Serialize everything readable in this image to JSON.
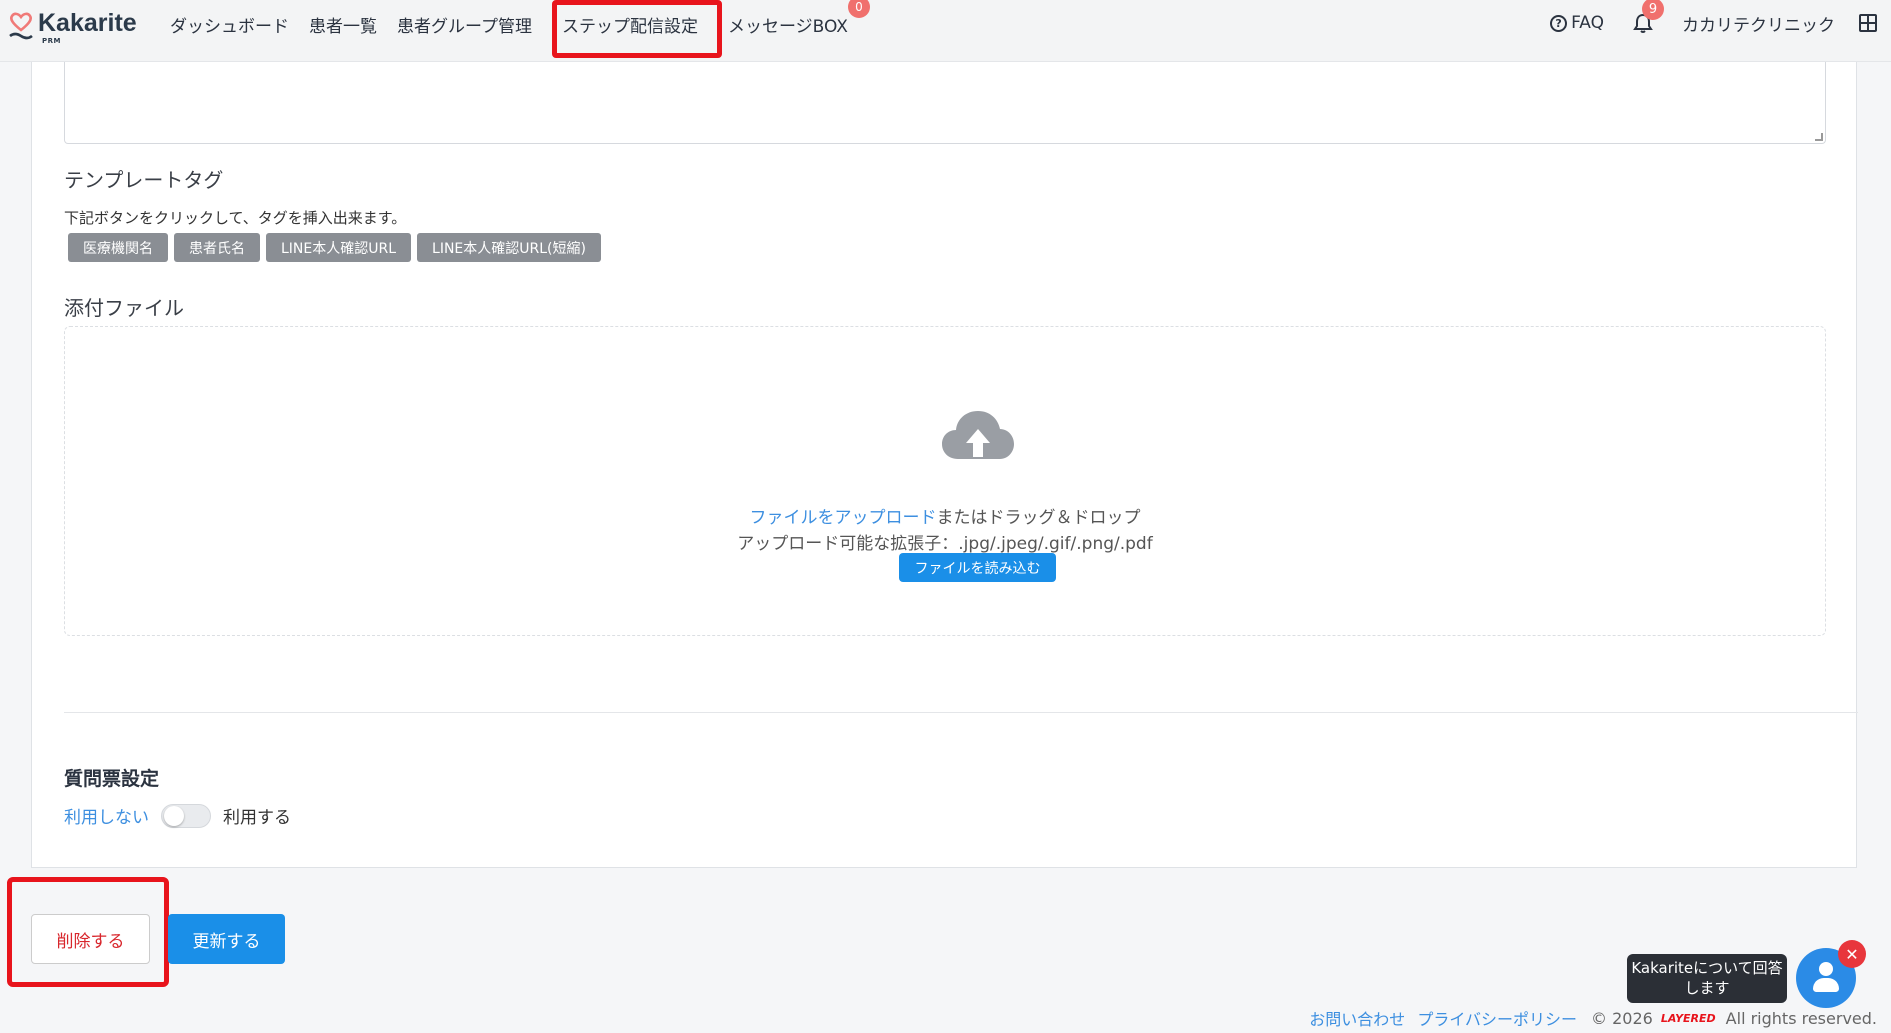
{
  "header": {
    "logo_text": "Kakarite",
    "logo_sub": "PRM",
    "nav": [
      {
        "label": "ダッシュボード"
      },
      {
        "label": "患者一覧"
      },
      {
        "label": "患者グループ管理"
      },
      {
        "label": "ステップ配信設定"
      },
      {
        "label": "メッセージBOX",
        "badge": "0"
      }
    ],
    "faq_label": "FAQ",
    "notification_count": "9",
    "clinic_name": "カカリテクリニック"
  },
  "template": {
    "title": "テンプレートタグ",
    "help": "下記ボタンをクリックして、タグを挿入出来ます。",
    "tags": [
      "医療機関名",
      "患者氏名",
      "LINE本人確認URL",
      "LINE本人確認URL(短縮)"
    ]
  },
  "attachment": {
    "title": "添付ファイル",
    "upload_link": "ファイルをアップロード",
    "drag_text": "またはドラッグ＆ドロップ",
    "extensions": "アップロード可能な拡張子：.jpg/.jpeg/.gif/.png/.pdf",
    "read_button": "ファイルを読み込む"
  },
  "questionnaire": {
    "title": "質問票設定",
    "off_label": "利用しない",
    "on_label": "利用する",
    "enabled": false
  },
  "actions": {
    "delete_label": "削除する",
    "update_label": "更新する"
  },
  "footer": {
    "contact": "お問い合わせ",
    "privacy": "プライバシーポリシー",
    "copyright": "© 2026",
    "brand": "LAYERED",
    "rights": "All rights reserved."
  },
  "chat": {
    "bubble_text": "Kakariteについて回答します",
    "close_symbol": "✕"
  },
  "colors": {
    "accent": "#1a8fe8",
    "highlight": "#e8141c",
    "link": "#3d8fe0"
  }
}
